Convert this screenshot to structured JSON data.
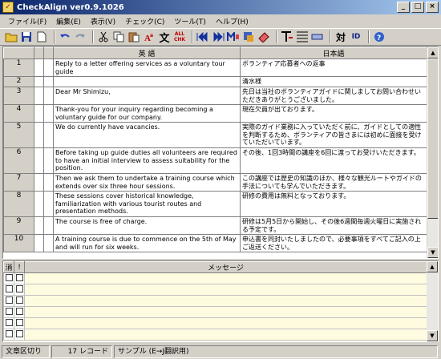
{
  "window": {
    "title": "CheckAlign ver0.9.1026",
    "icon_glyph": "✓"
  },
  "window_controls": {
    "minimize": "_",
    "maximize": "□",
    "close": "×"
  },
  "menu": [
    "ファイル(F)",
    "編集(E)",
    "表示(V)",
    "チェック(C)",
    "ツール(T)",
    "ヘルプ(H)"
  ],
  "toolbar": {
    "icons": [
      "open-folder-icon",
      "save-icon",
      "new-icon",
      "undo-icon",
      "redo-icon",
      "cut-icon",
      "copy-icon",
      "paste-icon",
      "font-icon",
      "text-icon",
      "check-all-icon",
      "prev-mark-icon",
      "next-mark-icon",
      "mark-icon",
      "mark-alt-icon",
      "eraser-icon",
      "align-icon",
      "align-justify-icon",
      "flag-icon",
      "pair-icon",
      "pair-alt-icon",
      "help-icon"
    ],
    "text_button": "文",
    "check_all_label": "ALL",
    "check_all_sub": "CHK",
    "pair_label": "対",
    "pair_alt_label": "ID"
  },
  "grid": {
    "header_en": "英 語",
    "header_ja": "日本語",
    "rows": [
      {
        "num": "1",
        "en": "Reply to a letter offering services as a voluntary tour guide",
        "ja": "ボランティア応募者への返事"
      },
      {
        "num": "2",
        "en": "",
        "ja": "清水様"
      },
      {
        "num": "3",
        "en": "Dear Mr Shimizu,",
        "ja": "先日は当社のボランティアガイドに関しましてお問い合わせいただきありがとうございました。"
      },
      {
        "num": "4",
        "en": "Thank-you for your inquiry regarding becoming a voluntary guide for our company.",
        "ja": "現在欠員が出ております。"
      },
      {
        "num": "5",
        "en": "We do currently have vacancies.",
        "ja": "実際のガイド業務に入っていただく前に、ガイドとしての適性を判断するため、ボランティアの皆さまには初めに面接を受けていただいています。"
      },
      {
        "num": "6",
        "en": "Before taking up guide duties all volunteers are required to have an initial interview to assess suitability for the position.",
        "ja": "その後、1回3時間の講座を6回に渡ってお受けいただきます。"
      },
      {
        "num": "7",
        "en": "Then we ask them to undertake a training course which extends over six three hour sessions.",
        "ja": "この講座では歴史の知識のほか、様々な観光ルートやガイドの手法についても学んでいただきます。"
      },
      {
        "num": "8",
        "en": "These sessions cover historical knowledge, familiarization with various tourist routes and presentation methods.",
        "ja": "研修の費用は無料となっております。"
      },
      {
        "num": "9",
        "en": "The course is free of charge.",
        "ja": "研修は5月5日から開始し、その後6週間毎週火曜日に実施される予定です。"
      },
      {
        "num": "10",
        "en": "A training course is due to commence on the 5th of May and will run for six weeks.",
        "ja": "申込書を同封いたしましたので、必要事項をすべてご記入の上ご返送ください。"
      }
    ]
  },
  "messages": {
    "header_del": "消",
    "header_bang": "!",
    "header_msg": "メッセージ",
    "row_count": 6
  },
  "status": {
    "mode": "文章区切り",
    "records": "17 レコード",
    "sample": "サンプル (E→J翻訳用)"
  }
}
